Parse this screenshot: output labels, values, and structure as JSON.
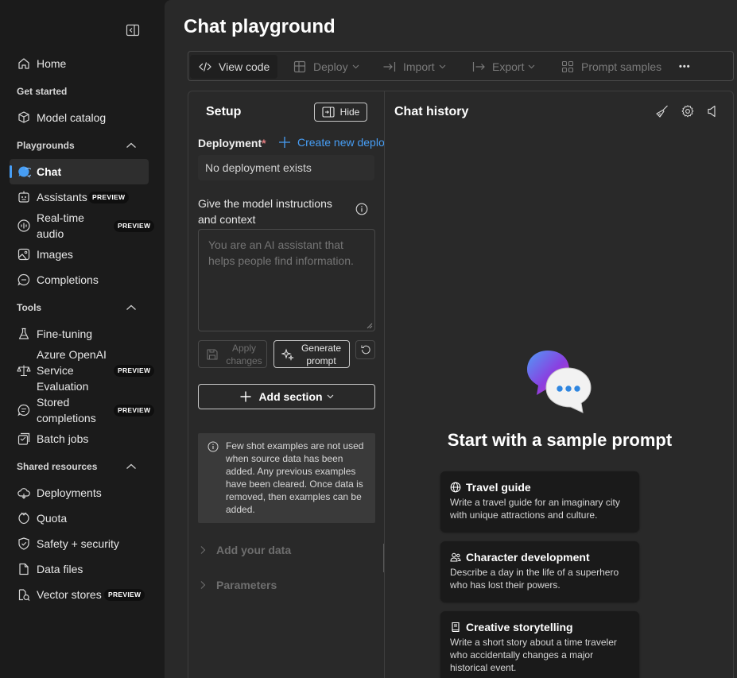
{
  "sidebar": {
    "items": [
      {
        "label": "Home",
        "icon": "home-icon"
      },
      {
        "label": "Model catalog",
        "icon": "cube-icon"
      },
      {
        "label": "Chat",
        "icon": "chat-icon"
      },
      {
        "label": "Assistants",
        "icon": "assistant-icon",
        "badge": "PREVIEW"
      },
      {
        "label": "Real-time audio",
        "icon": "audio-icon",
        "badge": "PREVIEW"
      },
      {
        "label": "Images",
        "icon": "image-icon"
      },
      {
        "label": "Completions",
        "icon": "completions-icon"
      },
      {
        "label": "Fine-tuning",
        "icon": "flask-icon"
      },
      {
        "label": "Azure OpenAI Service Evaluation",
        "icon": "scale-icon",
        "badge": "PREVIEW"
      },
      {
        "label": "Stored completions",
        "icon": "stored-icon",
        "badge": "PREVIEW"
      },
      {
        "label": "Batch jobs",
        "icon": "batch-icon"
      },
      {
        "label": "Deployments",
        "icon": "cloud-icon"
      },
      {
        "label": "Quota",
        "icon": "quota-icon"
      },
      {
        "label": "Safety + security",
        "icon": "shield-icon"
      },
      {
        "label": "Data files",
        "icon": "file-icon"
      },
      {
        "label": "Vector stores",
        "icon": "vector-icon",
        "badge": "PREVIEW"
      }
    ],
    "sections": {
      "get_started": "Get started",
      "playgrounds": "Playgrounds",
      "tools": "Tools",
      "shared": "Shared resources"
    }
  },
  "page": {
    "title": "Chat playground"
  },
  "toolbar": {
    "view_code": "View code",
    "deploy": "Deploy",
    "import": "Import",
    "export": "Export",
    "prompt_samples": "Prompt samples",
    "more": "•••"
  },
  "setup": {
    "title": "Setup",
    "hide": "Hide",
    "deployment_label": "Deployment",
    "required_mark": "*",
    "create_new": "Create new deployment",
    "deployment_value": "No deployment exists",
    "instructions_label": "Give the model instructions and context",
    "instructions_placeholder": "You are an AI assistant that helps people find information.",
    "apply_changes": "Apply changes",
    "generate_prompt": "Generate prompt",
    "add_section": "Add section",
    "notice": "Few shot examples are not used when source data has been added. Any previous examples have been cleared. Once data is removed, then examples can be added.",
    "add_your_data": "Add your data",
    "parameters": "Parameters"
  },
  "chat": {
    "title": "Chat history",
    "hero_title": "Start with a sample prompt",
    "samples": [
      {
        "title": "Travel guide",
        "icon": "globe-icon",
        "desc": "Write a travel guide for an imaginary city with unique attractions and culture."
      },
      {
        "title": "Character development",
        "icon": "people-icon",
        "desc": "Describe a day in the life of a superhero who has lost their powers."
      },
      {
        "title": "Creative storytelling",
        "icon": "book-icon",
        "desc": "Write a short story about a time traveler who accidentally changes a major historical event."
      }
    ]
  },
  "colors": {
    "accent": "#479ef5",
    "required": "#e37d80"
  }
}
